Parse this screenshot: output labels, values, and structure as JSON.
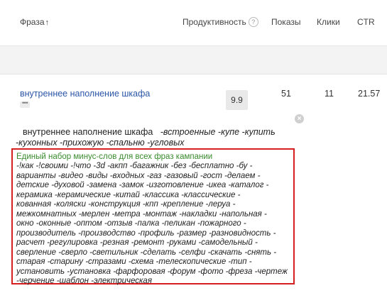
{
  "header": {
    "phrase": "Фраза",
    "sort_arrow": "↑",
    "productivity": "Продуктивность",
    "help_glyph": "?",
    "shows": "Показы",
    "clicks": "Клики",
    "ctr": "CTR"
  },
  "row": {
    "phrase": "внутреннее наполнение шкафа",
    "more": "•••",
    "productivity": "9.9",
    "shows": "51",
    "clicks": "11",
    "ctr": "21.57"
  },
  "popup": {
    "close": "×",
    "phrase": "внутреннее наполнение шкафа",
    "phrase_minus_words": "-встроенные -купе -купить -кухонных -прихожую -спальню -угловых",
    "campaign_title": "Единый набор минус-слов для всех фраз кампании",
    "campaign_minus_words": "-!как -!своими -!что -3d -акпп -багажник -без -бесплатно -бу -\nварианты -видео -виды -входных -газ -газовый -гост -делаем -\nдетские -духовой -замена -замок -изготовление -икеа -каталог -\nкерамика -керамические -китай -классика -классические -\nкованная -коляски -конструкция -кпп -крепление -леруа -\nмежкомнатных -мерлен -метра -монтаж -накладки -напольная -\nокно -оконные -оптом -отзыв -палка -пеликан -пожарного -\nпроизводитель -производство -профиль -размер -разновидность -\nрасчет -регулировка -резная -ремонт -руками -самодельный -\nсверление -сверло -светильник -сделать -селфи -скачать -снять -\nстарая -старину -стразами -схема -телескопические -тип -\nустановить -установка -фарфоровая -форум -фото -фреза -чертеж\n-черчение -шаблон -электрическая"
  },
  "colors": {
    "link": "#2b56a8",
    "highlight_border": "#d5201f",
    "campaign_title": "#3a8b2e"
  }
}
